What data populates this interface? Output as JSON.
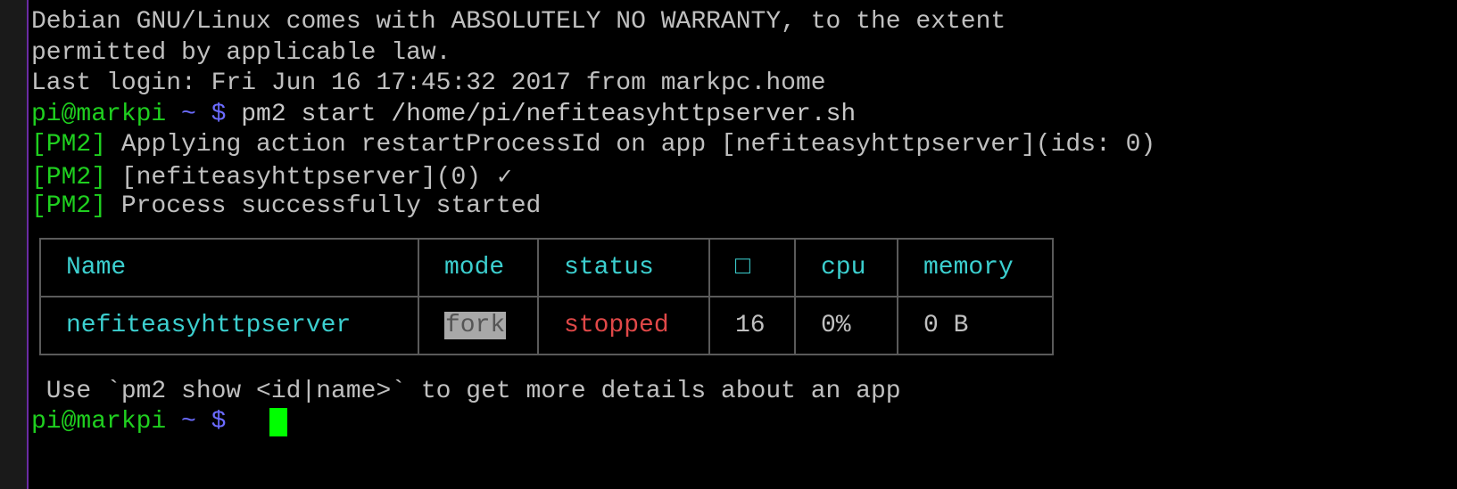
{
  "terminal": {
    "intro": [
      "Debian GNU/Linux comes with ABSOLUTELY NO WARRANTY, to the extent",
      "permitted by applicable law."
    ],
    "last_login": "Last login: Fri Jun 16 17:45:32 2017 from markpc.home",
    "prompt": {
      "user_host": "pi@markpi",
      "path": " ~ $",
      "command": " pm2 start /home/pi/nefiteasyhttpserver.sh"
    },
    "pm2_lines": [
      {
        "tag": "[PM2]",
        "text": " Applying action restartProcessId on app [nefiteasyhttpserver](ids: 0)"
      },
      {
        "tag": "[PM2]",
        "text": " [nefiteasyhttpserver](0) ",
        "suffix": "✓"
      },
      {
        "tag": "[PM2]",
        "text": " Process successfully started"
      }
    ],
    "table": {
      "headers": [
        "Name",
        "mode",
        "status",
        "□",
        "cpu",
        "memory"
      ],
      "rows": [
        {
          "name": "nefiteasyhttpserver",
          "mode": "fork",
          "status": "stopped",
          "restarts": "16",
          "cpu": "0%",
          "memory": "0 B"
        }
      ]
    },
    "hint": " Use `pm2 show <id|name>` to get more details about an app",
    "final_prompt": {
      "user_host": "pi@markpi",
      "path": " ~ $"
    }
  },
  "colors": {
    "prompt_green": "#1fcf1f",
    "prompt_blue": "#6b6bff",
    "table_cyan": "#3ccfcf",
    "status_red": "#e04848",
    "cursor": "#00ff00"
  }
}
